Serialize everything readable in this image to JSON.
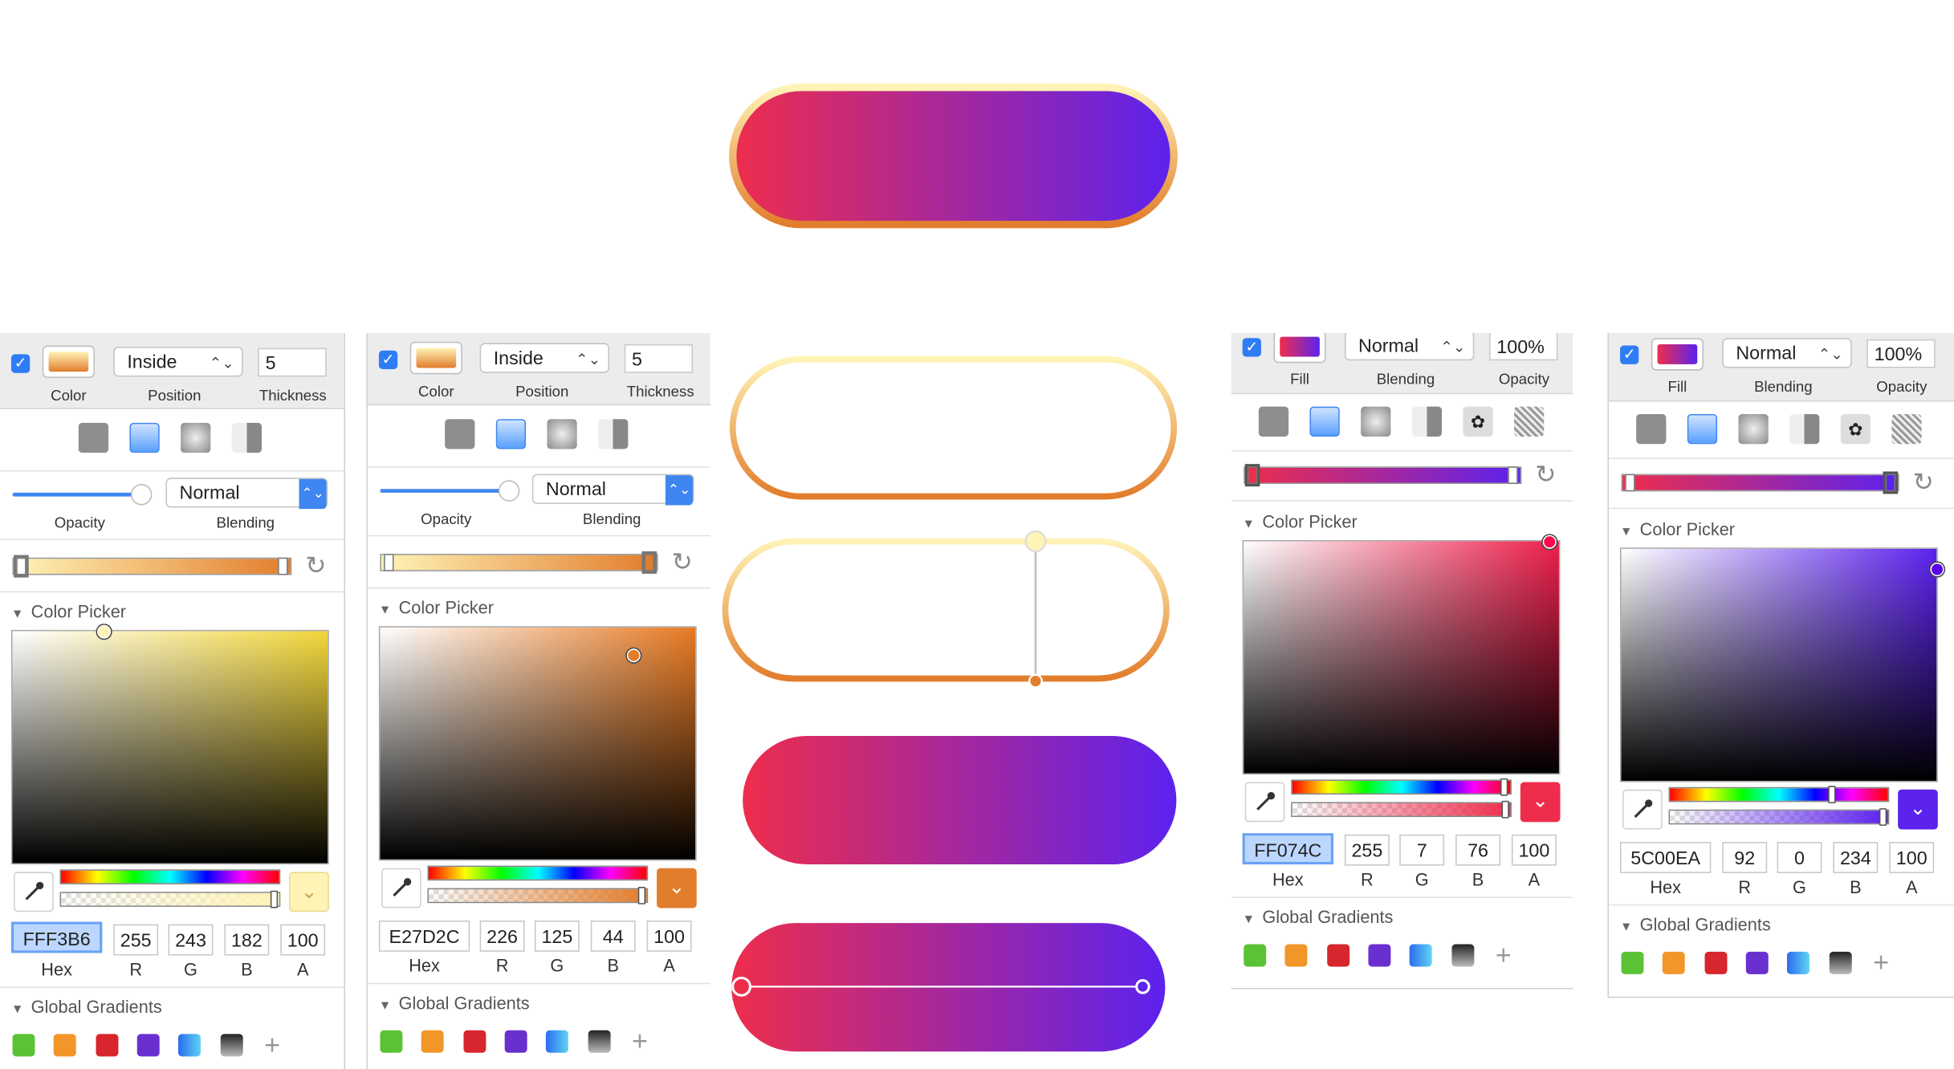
{
  "colors": {
    "grad_start": "#EE2D4C",
    "grad_end": "#5C22EE",
    "border_top": "#FFF3B6",
    "border_bottom": "#E27D2C",
    "accent_blue": "#2F7DF6"
  },
  "panel1": {
    "position_label": "Inside",
    "thickness_value": "5",
    "cap_color": "Color",
    "cap_position": "Position",
    "cap_thickness": "Thickness",
    "opacity_label": "Opacity",
    "opacity_level": 1.0,
    "blending_value": "Normal",
    "blending_label": "Blending",
    "color_picker_title": "Color Picker",
    "hex": "FFF3B6",
    "r": "255",
    "g": "243",
    "b": "182",
    "a": "100",
    "hex_label": "Hex",
    "r_label": "R",
    "g_label": "G",
    "b_label": "B",
    "a_label": "A",
    "global_gradients_title": "Global Gradients"
  },
  "panel2": {
    "position_label": "Inside",
    "thickness_value": "5",
    "cap_color": "Color",
    "cap_position": "Position",
    "cap_thickness": "Thickness",
    "opacity_label": "Opacity",
    "opacity_level": 1.0,
    "blending_value": "Normal",
    "blending_label": "Blending",
    "color_picker_title": "Color Picker",
    "hex": "E27D2C",
    "r": "226",
    "g": "125",
    "b": "44",
    "a": "100",
    "hex_label": "Hex",
    "r_label": "R",
    "g_label": "G",
    "b_label": "B",
    "a_label": "A",
    "global_gradients_title": "Global Gradients"
  },
  "panel3": {
    "blending_value": "Normal",
    "opacity_value": "100%",
    "cap_fill": "Fill",
    "cap_blending": "Blending",
    "cap_opacity": "Opacity",
    "color_picker_title": "Color Picker",
    "hex": "FF074C",
    "r": "255",
    "g": "7",
    "b": "76",
    "a": "100",
    "hex_label": "Hex",
    "r_label": "R",
    "g_label": "G",
    "b_label": "B",
    "a_label": "A",
    "global_gradients_title": "Global Gradients"
  },
  "panel4": {
    "blending_value": "Normal",
    "opacity_value": "100%",
    "cap_fill": "Fill",
    "cap_blending": "Blending",
    "cap_opacity": "Opacity",
    "color_picker_title": "Color Picker",
    "hex": "5C00EA",
    "r": "92",
    "g": "0",
    "b": "234",
    "a": "100",
    "hex_label": "Hex",
    "r_label": "R",
    "g_label": "G",
    "b_label": "B",
    "a_label": "A",
    "global_gradients_title": "Global Gradients"
  },
  "global_swatches": [
    "#5BC236",
    "#F2962A",
    "#D7262D",
    "#6A2FCF",
    "blue-gradient",
    "black-gradient"
  ],
  "icons": {
    "checkbox": "checkmark-icon",
    "stepper": "updown-chevron-icon",
    "eyedropper": "eyedropper-icon",
    "refresh": "rotate-icon",
    "add": "plus-icon",
    "dropdown": "chevron-down-icon"
  }
}
